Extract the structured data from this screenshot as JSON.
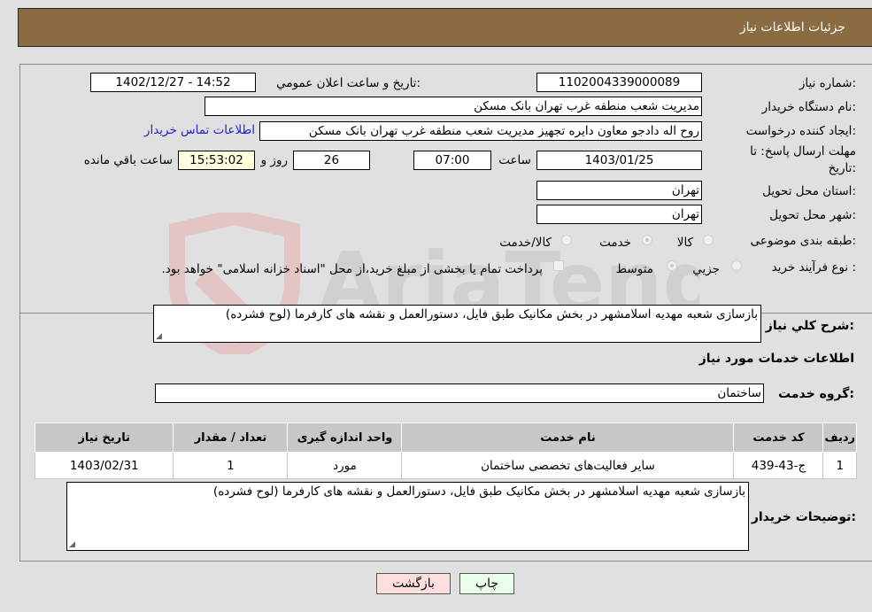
{
  "header": {
    "title": "جزئیات اطلاعات نیاز"
  },
  "fields": {
    "need_number_label": "شماره نیاز:",
    "need_number": "1102004339000089",
    "announce_label": "تاریخ و ساعت اعلان عمومي:",
    "announce_value": "1402/12/27 - 14:52",
    "buyer_org_label": "نام دستگاه خريدار:",
    "buyer_org": "مديريت شعب منطقه غرب تهران بانک مسکن",
    "creator_label": "ايجاد کننده درخواست:",
    "creator": "روح اله دادجو معاون دايره تجهيز  مديريت شعب منطقه غرب تهران بانک مسکن",
    "contact_link": "اطلاعات تماس خريدار",
    "deadline_label_1": "مهلت ارسال پاسخ: تا",
    "deadline_label_2": "تاریخ:",
    "deadline_date": "1403/01/25",
    "time_label": "ساعت",
    "deadline_time": "07:00",
    "days_value": "26",
    "days_label": "روز و",
    "remaining_time": "15:53:02",
    "remaining_label": "ساعت باقي مانده",
    "province_label": "استان محل تحویل:",
    "province": "تهران",
    "city_label": "شهر محل تحویل:",
    "city": "تهران",
    "category_label": "طبقه بندی موضوعی:",
    "category_options": [
      {
        "label": "کالا",
        "checked": false
      },
      {
        "label": "خدمت",
        "checked": true
      },
      {
        "label": "کالا/خدمت",
        "checked": false
      }
    ],
    "process_label": "نوع فرآيند خريد :",
    "process_options": [
      {
        "label": "جزيي",
        "checked": false
      },
      {
        "label": "متوسط",
        "checked": true
      }
    ],
    "treasury_note": "پرداخت تمام یا بخشی از مبلغ خرید،از محل \"اسناد خزانه اسلامی\" خواهد بود."
  },
  "description": {
    "label": "شرح کلي نياز:",
    "value": "بازسازی شعبه مهدیه اسلامشهر در بخش مکانیک طبق فایل، دستورالعمل و نقشه های کارفرما (لوح فشرده)"
  },
  "services": {
    "section_title": "اطلاعات خدمات مورد نياز",
    "group_label": "گروه خدمت:",
    "group_value": "ساختمان",
    "table": {
      "headers": [
        "رديف",
        "کد خدمت",
        "نام خدمت",
        "واحد اندازه گيری",
        "تعداد / مقدار",
        "تاريخ نياز"
      ],
      "rows": [
        [
          "1",
          "ج-43-439",
          "سایر فعالیت‌های تخصصی ساختمان",
          "مورد",
          "1",
          "1403/02/31"
        ]
      ]
    }
  },
  "buyer_notes": {
    "label": "توضيحات خريدار:",
    "value": "بازسازی شعبه مهدیه اسلامشهر در بخش مکانیک طبق فایل، دستورالعمل و نقشه های کارفرما (لوح فشرده)"
  },
  "buttons": {
    "print": "چاپ",
    "back": "بازگشت"
  },
  "watermark": {
    "text": "AriaTender.neT"
  },
  "colors": {
    "header_bg": "#8b6c42",
    "print_bg": "#eaffea",
    "back_bg": "#ffdede",
    "link": "#2222cc"
  }
}
